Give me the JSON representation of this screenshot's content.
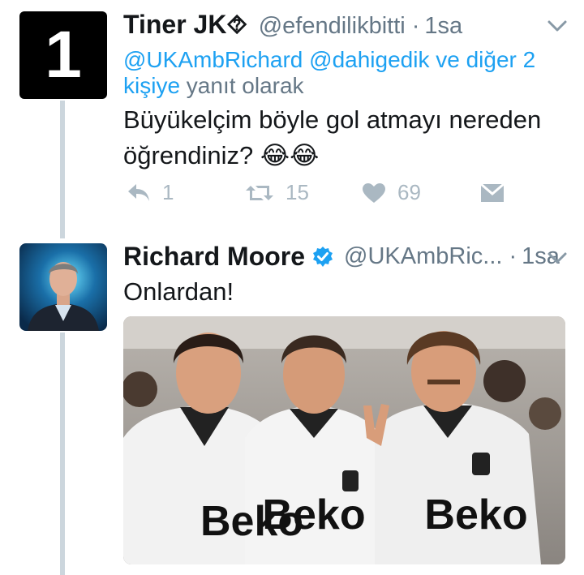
{
  "tweet1": {
    "avatar_text": "1",
    "name": "Tiner  JK⯑",
    "handle": "@efendilikbitti",
    "separator": "·",
    "time": "1sa",
    "reply_line1": "@UKAmbRichard @dahigedik ve diğer 2",
    "reply_line2_link": "kişiye",
    "reply_line2_rest": " yanıt olarak",
    "text_line1": "Büyükelçim böyle gol atmayı nereden",
    "text_line2": "öğrendiniz? 😂😂",
    "replies": "1",
    "retweets": "15",
    "likes": "69"
  },
  "tweet2": {
    "name": "Richard Moore",
    "handle": "@UKAmbRic...",
    "separator": "·",
    "time": "1sa",
    "text": "Onlardan!",
    "photo_shirt_text": "Beko"
  },
  "colors": {
    "link": "#1da1f2",
    "verified": "#1da1f2",
    "muted": "#657786",
    "icon": "#aab8c2",
    "thread_line": "#ccd6dd"
  }
}
